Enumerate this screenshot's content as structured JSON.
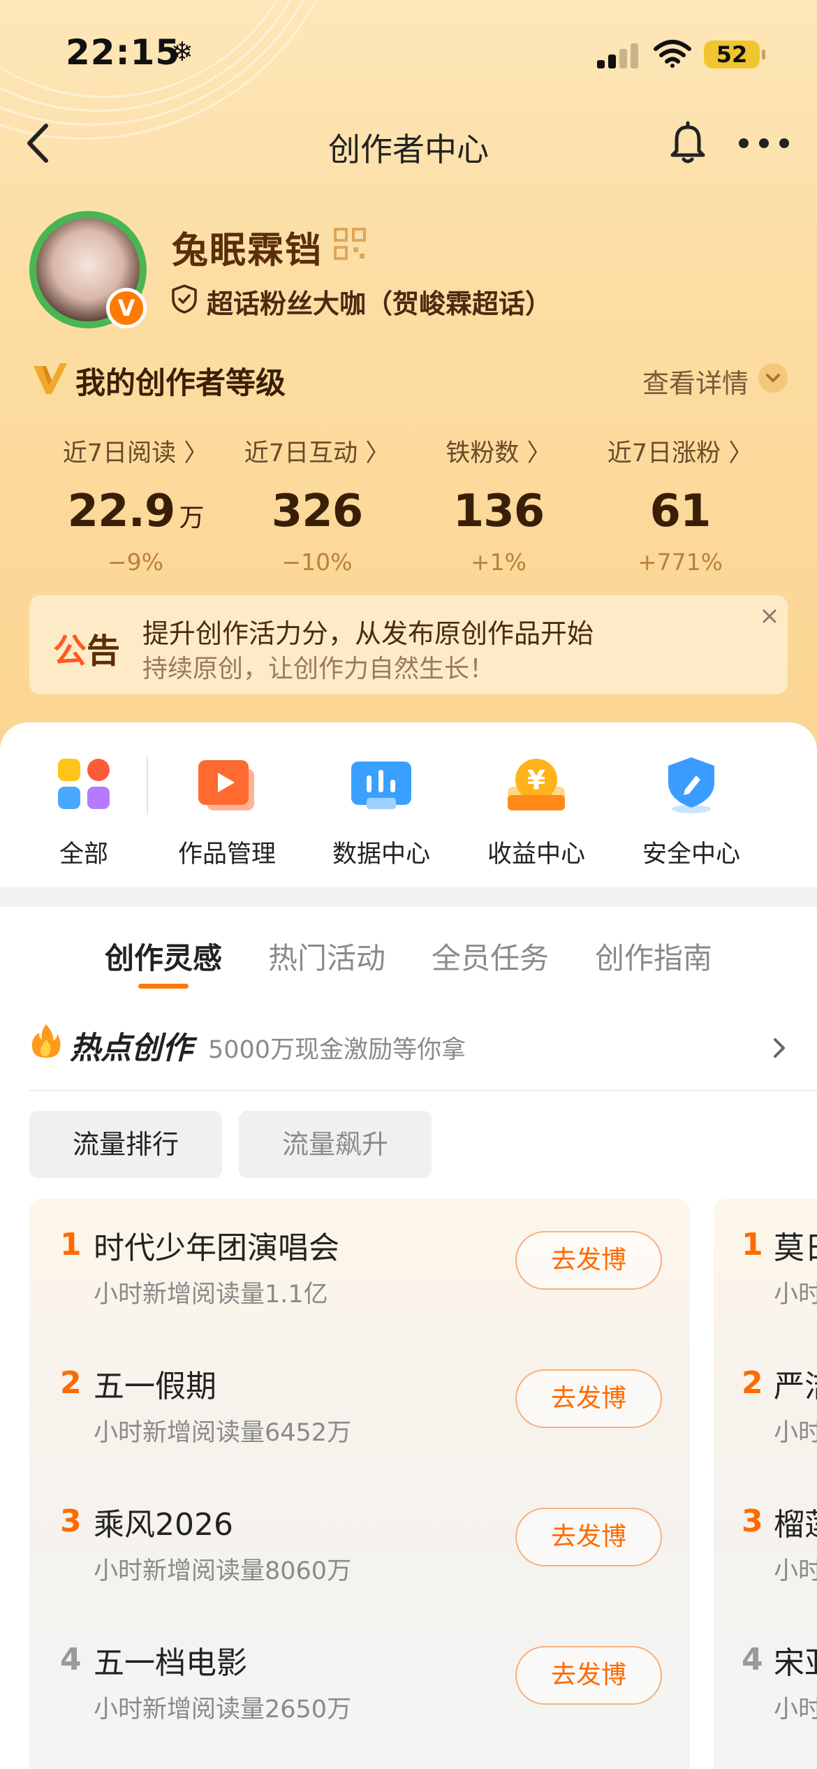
{
  "status_bar": {
    "time": "22:15",
    "battery": "52"
  },
  "nav": {
    "title": "创作者中心"
  },
  "profile": {
    "name": "兔眠霖铛",
    "badge_text": "超话粉丝大咖（贺峻霖超话）"
  },
  "level": {
    "title": "我的创作者等级",
    "detail_link": "查看详情"
  },
  "stats": [
    {
      "label": "近7日阅读 〉",
      "value": "22.9",
      "unit": "万",
      "change": "−9%"
    },
    {
      "label": "近7日互动 〉",
      "value": "326",
      "unit": "",
      "change": "−10%"
    },
    {
      "label": "铁粉数 〉",
      "value": "136",
      "unit": "",
      "change": "+1%"
    },
    {
      "label": "近7日涨粉 〉",
      "value": "61",
      "unit": "",
      "change": "+771%"
    }
  ],
  "notice": {
    "tag_first": "公",
    "tag_second": "告",
    "line1": "提升创作活力分，从发布原创作品开始",
    "line2": "持续原创，让创作力自然生长！"
  },
  "tools": [
    {
      "label": "全部",
      "icon": "grid-apps-icon"
    },
    {
      "label": "作品管理",
      "icon": "play-video-icon"
    },
    {
      "label": "数据中心",
      "icon": "bar-chart-icon"
    },
    {
      "label": "收益中心",
      "icon": "yuan-coin-icon"
    },
    {
      "label": "安全中心",
      "icon": "shield-pen-icon"
    }
  ],
  "tabs": [
    {
      "label": "创作灵感",
      "active": true
    },
    {
      "label": "热门活动",
      "active": false
    },
    {
      "label": "全员任务",
      "active": false
    },
    {
      "label": "创作指南",
      "active": false
    }
  ],
  "hot_section": {
    "title": "热点创作",
    "subtitle": "5000万现金激励等你拿"
  },
  "filters": [
    {
      "label": "流量排行",
      "active": true
    },
    {
      "label": "流量飙升",
      "active": false
    }
  ],
  "trending": [
    {
      "rank": "1",
      "title": "时代少年团演唱会",
      "sub": "小时新增阅读量1.1亿",
      "button": "去发博"
    },
    {
      "rank": "2",
      "title": "五一假期",
      "sub": "小时新增阅读量6452万",
      "button": "去发博"
    },
    {
      "rank": "3",
      "title": "乘风2026",
      "sub": "小时新增阅读量8060万",
      "button": "去发博"
    },
    {
      "rank": "4",
      "title": "五一档电影",
      "sub": "小时新增阅读量2650万",
      "button": "去发博"
    }
  ],
  "trending_second": [
    {
      "rank": "1",
      "title": "莫日",
      "sub": "小时"
    },
    {
      "rank": "2",
      "title": "严洁",
      "sub": "小时"
    },
    {
      "rank": "3",
      "title": "榴莲",
      "sub": "小时"
    },
    {
      "rank": "4",
      "title": "宋亚",
      "sub": "小时"
    }
  ],
  "colors": {
    "accent": "#ff7a00",
    "rank_top": "#ff6a00",
    "rank_other": "#9a9a9a",
    "hero_bg": "#fcdca0"
  }
}
